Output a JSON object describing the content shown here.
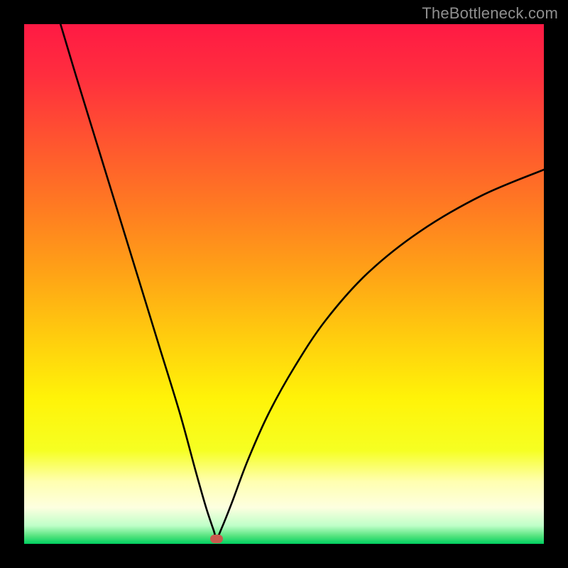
{
  "watermark": "TheBottleneck.com",
  "colors": {
    "frame": "#000000",
    "gradient_stops": [
      {
        "offset": 0.0,
        "color": "#ff1a44"
      },
      {
        "offset": 0.1,
        "color": "#ff2e3e"
      },
      {
        "offset": 0.22,
        "color": "#ff5330"
      },
      {
        "offset": 0.35,
        "color": "#ff7a22"
      },
      {
        "offset": 0.48,
        "color": "#ffa316"
      },
      {
        "offset": 0.6,
        "color": "#ffcc0e"
      },
      {
        "offset": 0.72,
        "color": "#fff308"
      },
      {
        "offset": 0.82,
        "color": "#f6ff22"
      },
      {
        "offset": 0.88,
        "color": "#ffffb0"
      },
      {
        "offset": 0.93,
        "color": "#fdffe0"
      },
      {
        "offset": 0.965,
        "color": "#bfffc8"
      },
      {
        "offset": 0.985,
        "color": "#54e37e"
      },
      {
        "offset": 1.0,
        "color": "#00d060"
      }
    ],
    "curve": "#000000",
    "marker": "#c95a4e"
  },
  "chart_data": {
    "type": "line",
    "title": "",
    "xlabel": "",
    "ylabel": "",
    "xlim": [
      0,
      100
    ],
    "ylim": [
      0,
      100
    ],
    "min_point": {
      "x": 37,
      "y": 1
    },
    "series": [
      {
        "name": "bottleneck-curve-left",
        "x": [
          7,
          10,
          14,
          18,
          22,
          26,
          30,
          33,
          35,
          36.5,
          37
        ],
        "values": [
          100,
          90,
          77,
          64,
          51,
          38,
          25,
          14,
          7,
          2.5,
          1
        ]
      },
      {
        "name": "bottleneck-curve-right",
        "x": [
          37,
          38,
          40,
          43,
          47,
          52,
          58,
          66,
          76,
          88,
          100
        ],
        "values": [
          1,
          3,
          8,
          16,
          25,
          34,
          43,
          52,
          60,
          67,
          72
        ]
      }
    ],
    "annotations": [
      {
        "name": "optimal-marker",
        "x": 37,
        "y": 1
      }
    ]
  }
}
